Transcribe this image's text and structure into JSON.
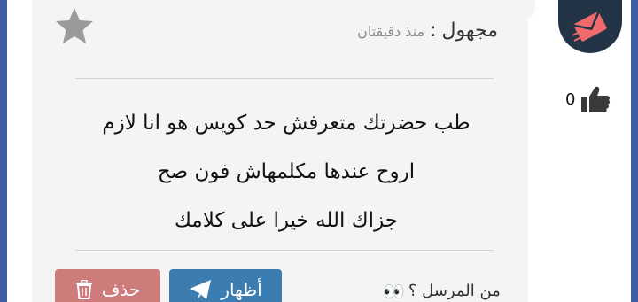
{
  "message": {
    "author": "مجهول",
    "separator": ":",
    "time": "منذ دقيقتان",
    "lines": [
      "طب حضرتك متعرفش حد كويس هو انا لازم",
      "اروح عندها مكلمهاش فون صح",
      "جزاك الله خيرا على كلامك"
    ]
  },
  "actions": {
    "reveal_label": "أظهار",
    "delete_label": "حذف",
    "who_sent": "من المرسل ؟",
    "who_sent_emoji": "👀"
  },
  "likes": {
    "count": "0"
  },
  "icons": {
    "favorite": "star-icon",
    "reveal": "paper-plane-icon",
    "delete": "trash-icon",
    "like": "thumbs-up-icon",
    "avatar": "envelope-logo-icon"
  },
  "colors": {
    "frame": "#3f5ea6",
    "card": "#f4f4f4",
    "reveal_button": "#3b7db1",
    "delete_button": "#ce7b7b",
    "avatar_bg": "#243447",
    "avatar_accent": "#ef6b6b",
    "star": "#9a9a9a"
  }
}
